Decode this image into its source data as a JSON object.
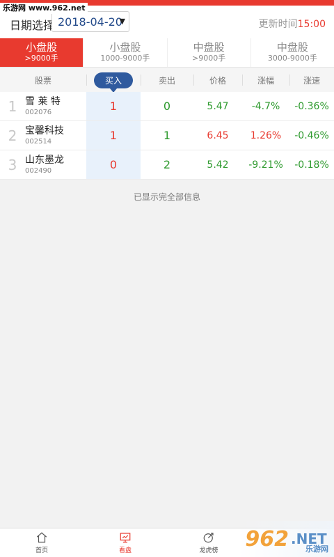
{
  "watermark": "乐游网 www.962.net",
  "header": {
    "date_label": "日期选择",
    "date_value": "2018-04-20",
    "update_label": "更新时间",
    "update_time": "15:00"
  },
  "tabs": [
    {
      "title": "小盘股",
      "sub": ">9000手",
      "active": true
    },
    {
      "title": "小盘股",
      "sub": "1000-9000手",
      "active": false
    },
    {
      "title": "中盘股",
      "sub": ">9000手",
      "active": false
    },
    {
      "title": "中盘股",
      "sub": "3000-9000手",
      "active": false
    }
  ],
  "columns": {
    "name": "股票",
    "buy": "买入",
    "sell": "卖出",
    "price": "价格",
    "change": "涨幅",
    "speed": "涨速"
  },
  "rows": [
    {
      "rank": "1",
      "name": "雪 莱 特",
      "code": "002076",
      "buy": "1",
      "sell": "0",
      "price": "5.47",
      "change": "-4.7%",
      "speed": "-0.36%"
    },
    {
      "rank": "2",
      "name": "宝馨科技",
      "code": "002514",
      "buy": "1",
      "sell": "1",
      "price": "6.45",
      "change": "1.26%",
      "speed": "-0.46%"
    },
    {
      "rank": "3",
      "name": "山东墨龙",
      "code": "002490",
      "buy": "0",
      "sell": "2",
      "price": "5.42",
      "change": "-9.21%",
      "speed": "-0.18%"
    }
  ],
  "footnote": "已显示完全部信息",
  "bottom_nav": [
    {
      "label": "首页",
      "icon": "home-icon"
    },
    {
      "label": "看盘",
      "icon": "monitor-icon"
    },
    {
      "label": "龙虎榜",
      "icon": "dragon-icon"
    }
  ],
  "logo": {
    "big": "962",
    "net": ".NET",
    "cn": "乐游网"
  },
  "colors": {
    "accent": "#e83a2f",
    "buy_blue": "#2f5a9e",
    "green": "#2e9a2e"
  }
}
